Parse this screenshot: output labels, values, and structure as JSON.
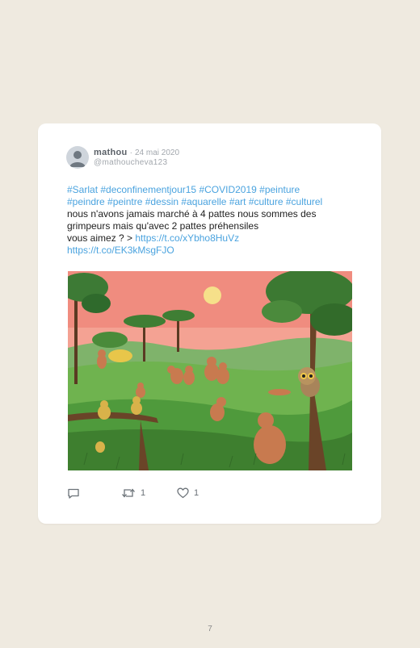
{
  "tweet": {
    "author_name": "mathou",
    "separator": "·",
    "date": "24 mai 2020",
    "handle": "@mathoucheva123",
    "hashtags_line1": "#Sarlat #deconfinementjour15 #COVID2019 #peinture",
    "hashtags_line2": "#peindre #peintre #dessin #aquarelle #art #culture #culturel",
    "text_line1": "nous n'avons jamais marché à 4 pattes nous sommes des",
    "text_line2": "grimpeurs mais qu'avec 2 pattes préhensiles",
    "text_line3_prefix": "vous aimez ? > ",
    "link1": "https://t.co/xYbho8HuVz",
    "link2": "https://t.co/EK3kMsgFJO",
    "link_color": "#4aa3df"
  },
  "actions": {
    "reply_icon": "reply-icon",
    "retweet_icon": "retweet-icon",
    "retweet_count": "1",
    "like_icon": "heart-icon",
    "like_count": "1"
  },
  "page": {
    "number": "7",
    "background": "#efeae0"
  }
}
